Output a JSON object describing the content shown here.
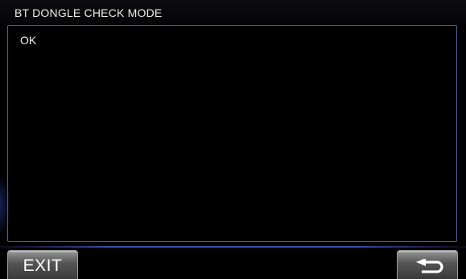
{
  "screen": {
    "title": "BT DONGLE CHECK MODE",
    "result": "OK"
  },
  "footer": {
    "exit_label": "EXIT",
    "back_icon": "return-arrow-icon"
  },
  "colors": {
    "background": "#000000",
    "panel_border": "#4f5f9e",
    "accent_line": "#3a4fb0",
    "button_gradient_top": "#c9c9c9",
    "button_gradient_bottom": "#3a3a3a",
    "text": "#f0f0f0"
  }
}
